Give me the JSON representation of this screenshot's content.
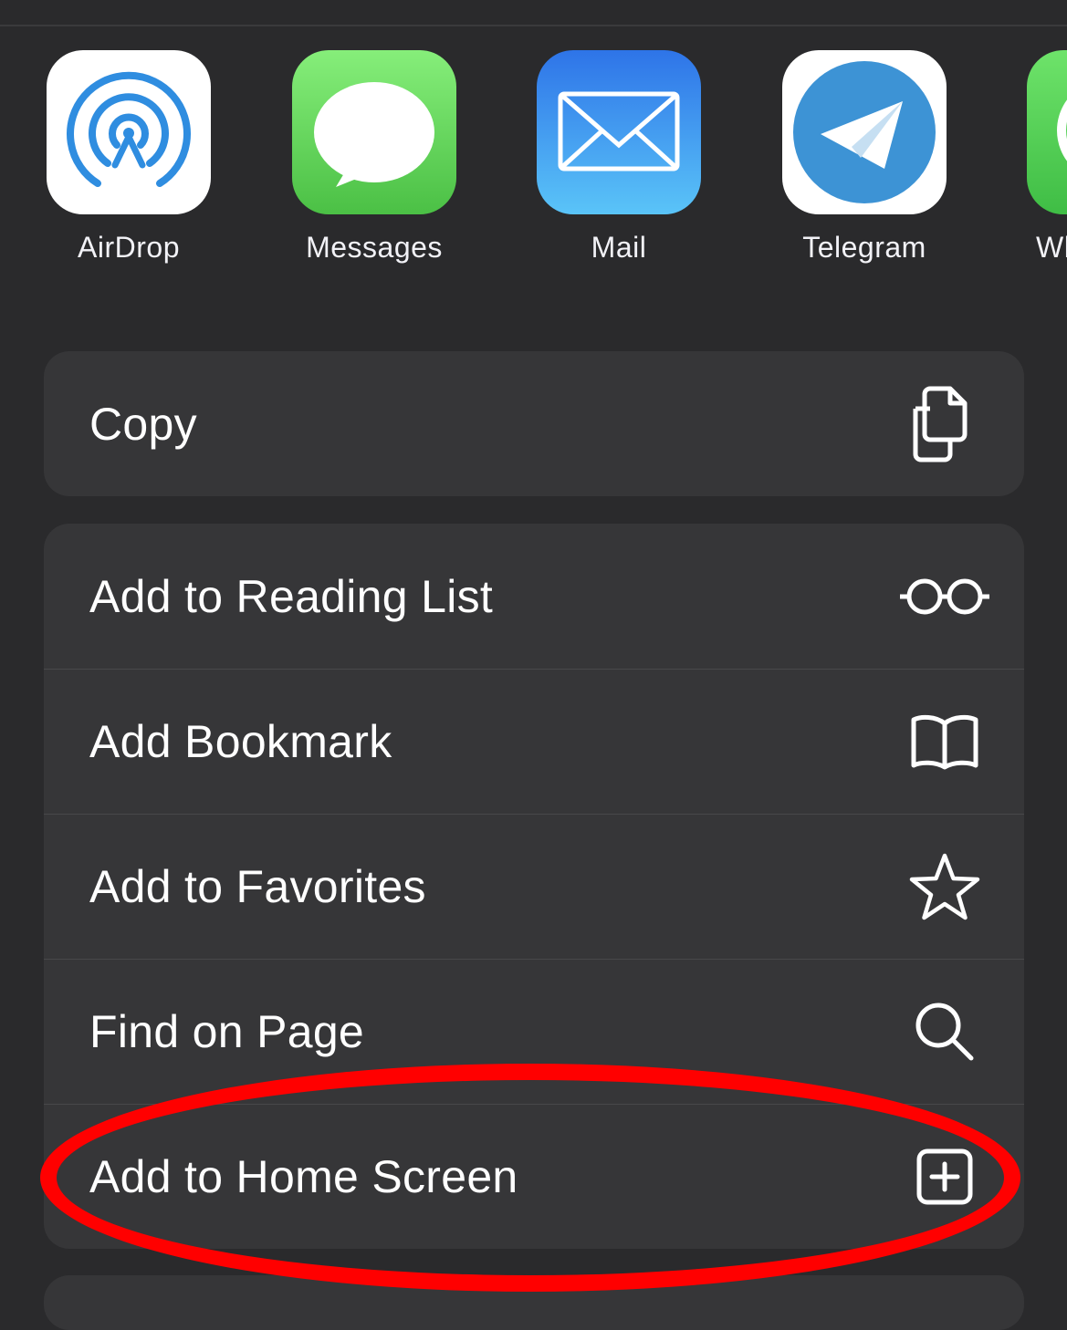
{
  "share_apps": [
    {
      "label": "AirDrop",
      "icon": "airdrop-icon"
    },
    {
      "label": "Messages",
      "icon": "messages-icon"
    },
    {
      "label": "Mail",
      "icon": "mail-icon"
    },
    {
      "label": "Telegram",
      "icon": "telegram-icon"
    },
    {
      "label": "WhatsApp",
      "icon": "whatsapp-icon",
      "visible_label": "Wh"
    }
  ],
  "actions_group_1": [
    {
      "label": "Copy",
      "icon": "copy-icon"
    }
  ],
  "actions_group_2": [
    {
      "label": "Add to Reading List",
      "icon": "glasses-icon"
    },
    {
      "label": "Add Bookmark",
      "icon": "book-icon"
    },
    {
      "label": "Add to Favorites",
      "icon": "star-icon"
    },
    {
      "label": "Find on Page",
      "icon": "search-icon"
    },
    {
      "label": "Add to Home Screen",
      "icon": "plus-square-icon",
      "highlighted": true
    }
  ],
  "colors": {
    "background": "#2a2a2c",
    "group_background": "#363638",
    "highlight": "#ff0000"
  }
}
